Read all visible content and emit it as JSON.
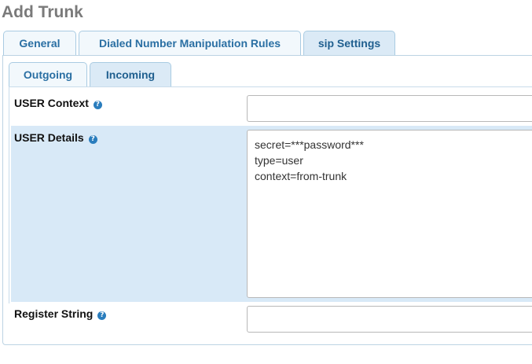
{
  "page": {
    "title": "Add Trunk"
  },
  "main_tabs": [
    {
      "label": "General"
    },
    {
      "label": "Dialed Number Manipulation Rules"
    },
    {
      "label": "sip Settings"
    }
  ],
  "sub_tabs": [
    {
      "label": "Outgoing"
    },
    {
      "label": "Incoming"
    }
  ],
  "form": {
    "user_context": {
      "label": "USER Context",
      "value": ""
    },
    "user_details": {
      "label": "USER Details",
      "value": "secret=***password***\ntype=user\ncontext=from-trunk"
    },
    "register_string": {
      "label": "Register String",
      "value": ""
    }
  },
  "icons": {
    "help": "help-circle-icon"
  },
  "colors": {
    "tab_text": "#2a6fa3",
    "highlight_row": "#d8e9f7",
    "help_icon": "#2a7dbd",
    "title": "#7a7a7a"
  }
}
